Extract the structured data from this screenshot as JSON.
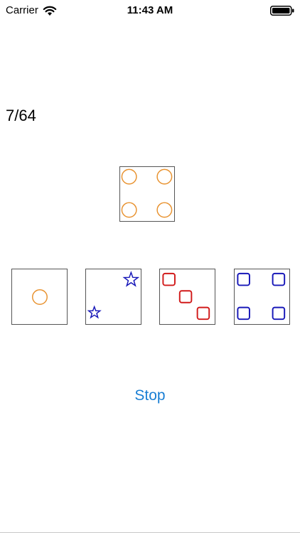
{
  "status_bar": {
    "carrier": "Carrier",
    "time": "11:43 AM",
    "icons": [
      "wifi-icon",
      "battery-icon"
    ]
  },
  "game": {
    "progress": "7/64",
    "stop_label": "Stop",
    "colors": {
      "orange": "#e8922f",
      "blue": "#1717b8",
      "red": "#d11a1a",
      "link": "#1a7fd4"
    },
    "target_card": {
      "shape": "circle",
      "color": "orange",
      "count": 4
    },
    "choice_cards": [
      {
        "shape": "circle",
        "color": "orange",
        "count": 1
      },
      {
        "shape": "star",
        "color": "blue",
        "count": 2
      },
      {
        "shape": "square",
        "color": "red",
        "count": 3
      },
      {
        "shape": "square",
        "color": "blue",
        "count": 4
      }
    ]
  }
}
